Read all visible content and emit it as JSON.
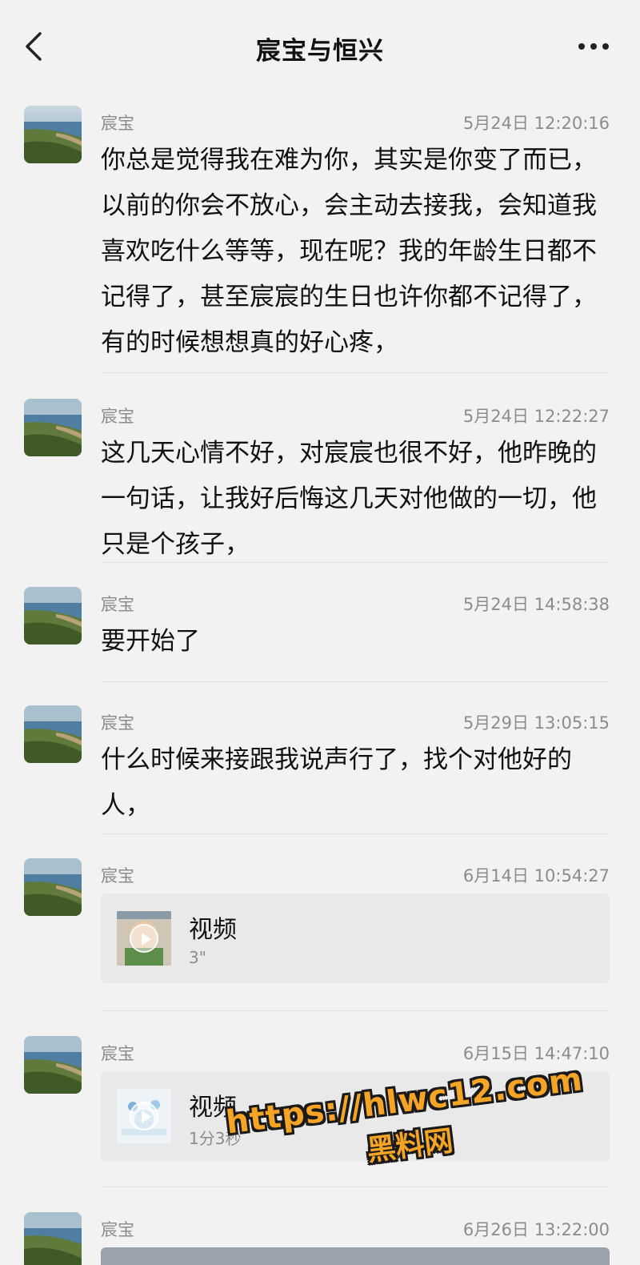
{
  "header": {
    "title": "宸宝与恒兴",
    "back_icon": "chevron-left-icon",
    "more_icon": "more-dots-icon"
  },
  "messages": [
    {
      "sender": "宸宝",
      "time": "5月24日 12:20:16",
      "text": "你总是觉得我在难为你，其实是你变了而已，以前的你会不放心，会主动去接我，会知道我喜欢吃什么等等，现在呢？我的年龄生日都不记得了，甚至宸宸的生日也许你都不记得了，有的时候想想真的好心疼，"
    },
    {
      "sender": "宸宝",
      "time": "5月24日 12:22:27",
      "text": "这几天心情不好，对宸宸也很不好，他昨晚的一句话，让我好后悔这几天对他做的一切，他只是个孩子，"
    },
    {
      "sender": "宸宝",
      "time": "5月24日 14:58:38",
      "text": "要开始了"
    },
    {
      "sender": "宸宝",
      "time": "5月29日 13:05:15",
      "text": "什么时候来接跟我说声行了，找个对他好的人，"
    },
    {
      "sender": "宸宝",
      "time": "6月14日 10:54:27",
      "video_title": "视频",
      "video_duration": "3\""
    },
    {
      "sender": "宸宝",
      "time": "6月15日 14:47:10",
      "video_title": "视频",
      "video_duration": "1分3秒"
    },
    {
      "sender": "宸宝",
      "time": "6月26日 13:22:00"
    }
  ],
  "watermark": {
    "url": "https://hlwc12.com",
    "name": "黑料网"
  },
  "colors": {
    "background": "#f2f2f2",
    "meta_text": "#8c8c8c",
    "watermark_fill": "#f5a425"
  }
}
